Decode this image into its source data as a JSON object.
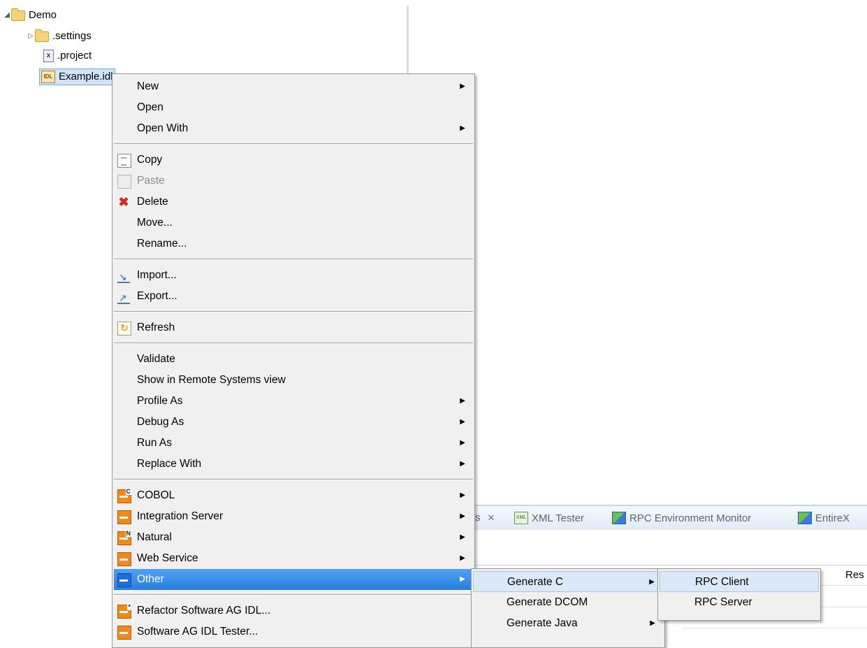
{
  "tree": {
    "items": [
      {
        "label": "Demo",
        "icon": "folder-open-icon"
      },
      {
        "label": ".settings",
        "icon": "folder-icon"
      },
      {
        "label": ".project",
        "icon": "xml-file-icon"
      },
      {
        "label": "Example.idl",
        "icon": "idl-file-icon"
      }
    ]
  },
  "views": {
    "tabs": [
      {
        "label": "s",
        "icon": "view-icon"
      },
      {
        "label": "XML Tester",
        "icon": "xml-tester-icon"
      },
      {
        "label": "RPC Environment Monitor",
        "icon": "rpc-monitor-icon"
      },
      {
        "label": "EntireX",
        "icon": "entirex-icon"
      }
    ],
    "column_header": "Res"
  },
  "context_menu": {
    "items": [
      {
        "label": "New",
        "submenu": true
      },
      {
        "label": "Open"
      },
      {
        "label": "Open With",
        "submenu": true
      },
      {
        "label": "Copy",
        "icon": "copy-icon"
      },
      {
        "label": "Paste",
        "icon": "paste-icon",
        "disabled": true
      },
      {
        "label": "Delete",
        "icon": "delete-icon"
      },
      {
        "label": "Move..."
      },
      {
        "label": "Rename..."
      },
      {
        "label": "Import...",
        "icon": "import-icon"
      },
      {
        "label": "Export...",
        "icon": "export-icon"
      },
      {
        "label": "Refresh",
        "icon": "refresh-icon"
      },
      {
        "label": "Validate"
      },
      {
        "label": "Show in Remote Systems view"
      },
      {
        "label": "Profile As",
        "submenu": true
      },
      {
        "label": "Debug As",
        "submenu": true
      },
      {
        "label": "Run As",
        "submenu": true
      },
      {
        "label": "Replace With",
        "submenu": true
      },
      {
        "label": "COBOL",
        "icon": "cobol-icon",
        "submenu": true
      },
      {
        "label": "Integration Server",
        "icon": "integration-server-icon",
        "submenu": true
      },
      {
        "label": "Natural",
        "icon": "natural-icon",
        "submenu": true
      },
      {
        "label": "Web Service",
        "icon": "web-service-icon",
        "submenu": true
      },
      {
        "label": "Other",
        "icon": "other-icon",
        "submenu": true,
        "highlighted": true
      },
      {
        "label": "Refactor Software AG IDL...",
        "icon": "refactor-icon"
      },
      {
        "label": "Software AG IDL Tester...",
        "icon": "idl-tester-icon"
      }
    ]
  },
  "other_submenu": {
    "items": [
      {
        "label": "Generate C",
        "submenu": true,
        "highlighted": true
      },
      {
        "label": "Generate DCOM"
      },
      {
        "label": "Generate Java",
        "submenu": true
      }
    ]
  },
  "generate_c_submenu": {
    "items": [
      {
        "label": "RPC Client",
        "highlighted": true
      },
      {
        "label": "RPC Server"
      }
    ]
  },
  "colors": {
    "highlight": "#2b7fdc",
    "submenu_hover": "#dbe8f7",
    "menu_background": "#f0f0f0",
    "tree_selection": "#cfe4f9"
  }
}
